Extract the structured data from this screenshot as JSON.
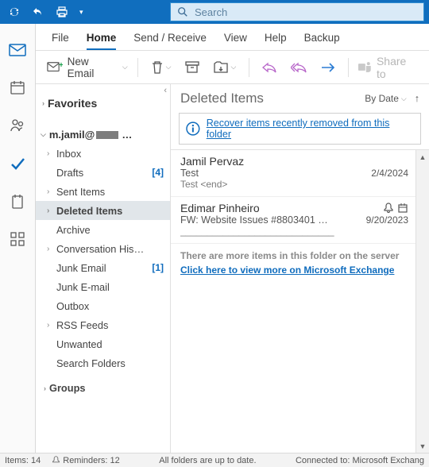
{
  "search": {
    "placeholder": "Search"
  },
  "tabs": {
    "file": "File",
    "home": "Home",
    "sendrecv": "Send / Receive",
    "view": "View",
    "help": "Help",
    "backup": "Backup"
  },
  "ribbon": {
    "new_email": "New Email",
    "share": "Share to"
  },
  "folders": {
    "favorites": "Favorites",
    "account": "m.jamil@",
    "items": {
      "inbox": "Inbox",
      "drafts": "Drafts",
      "drafts_count": "[4]",
      "sent": "Sent Items",
      "deleted": "Deleted Items",
      "archive": "Archive",
      "convo": "Conversation His…",
      "junk1": "Junk Email",
      "junk1_count": "[1]",
      "junk2": "Junk E-mail",
      "outbox": "Outbox",
      "rss": "RSS Feeds",
      "unwanted": "Unwanted",
      "search": "Search Folders"
    },
    "groups": "Groups"
  },
  "list": {
    "title": "Deleted Items",
    "sort_label": "By Date",
    "recover": "Recover items recently removed from this folder",
    "more_info": "There are more items in this folder on the server",
    "more_link": "Click here to view more on Microsoft Exchange",
    "msgs": [
      {
        "from": "Jamil Pervaz",
        "subj": "Test",
        "date": "2/4/2024",
        "preview": "Test <end>",
        "bell": false,
        "flag": false
      },
      {
        "from": "Edimar Pinheiro",
        "subj": "FW: Website Issues #8803401 …",
        "date": "9/20/2023",
        "preview": "_____________________________",
        "bell": true,
        "flag": true
      }
    ]
  },
  "status": {
    "items": "Items: 14",
    "reminders": "Reminders: 12",
    "mid": "All folders are up to date.",
    "right": "Connected to: Microsoft Exchang"
  }
}
